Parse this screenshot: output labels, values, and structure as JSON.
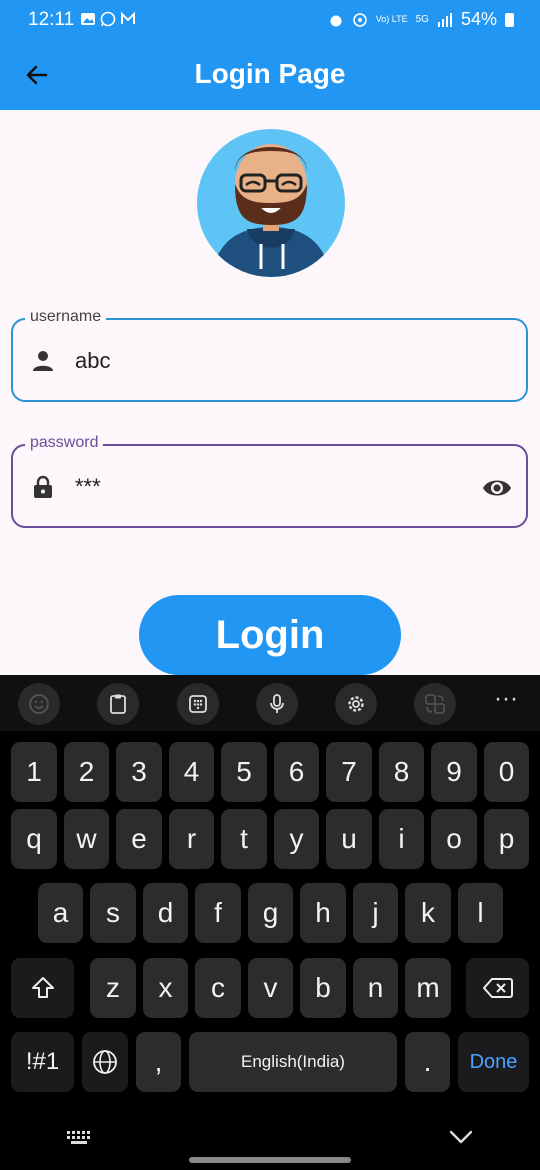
{
  "status_bar": {
    "time": "12:11",
    "battery": "54%",
    "network": "Vo) LTE",
    "signal_label": "5G"
  },
  "app_bar": {
    "title": "Login Page",
    "back_icon": "arrow-back-icon"
  },
  "form": {
    "username": {
      "label": "username",
      "value": "abc",
      "icon": "person-icon"
    },
    "password": {
      "label": "password",
      "value": "***",
      "icon": "lock-icon",
      "toggle_icon": "eye-icon"
    },
    "login_label": "Login"
  },
  "keyboard": {
    "toolbar_icons": [
      "emoji-icon",
      "clipboard-icon",
      "keypad-icon",
      "mic-icon",
      "settings-icon",
      "translate-icon",
      "more-icon"
    ],
    "row_numbers": [
      "1",
      "2",
      "3",
      "4",
      "5",
      "6",
      "7",
      "8",
      "9",
      "0"
    ],
    "row1": [
      "q",
      "w",
      "e",
      "r",
      "t",
      "y",
      "u",
      "i",
      "o",
      "p"
    ],
    "row2": [
      "a",
      "s",
      "d",
      "f",
      "g",
      "h",
      "j",
      "k",
      "l"
    ],
    "row3": [
      "z",
      "x",
      "c",
      "v",
      "b",
      "n",
      "m"
    ],
    "symbols_label": "!#1",
    "comma_label": ",",
    "space_label": "English(India)",
    "period_label": ".",
    "done_label": "Done"
  },
  "colors": {
    "primary": "#2196f3",
    "username_border": "#2a93d5",
    "password_border": "#6b4e9a",
    "background": "#fdf7fc"
  }
}
